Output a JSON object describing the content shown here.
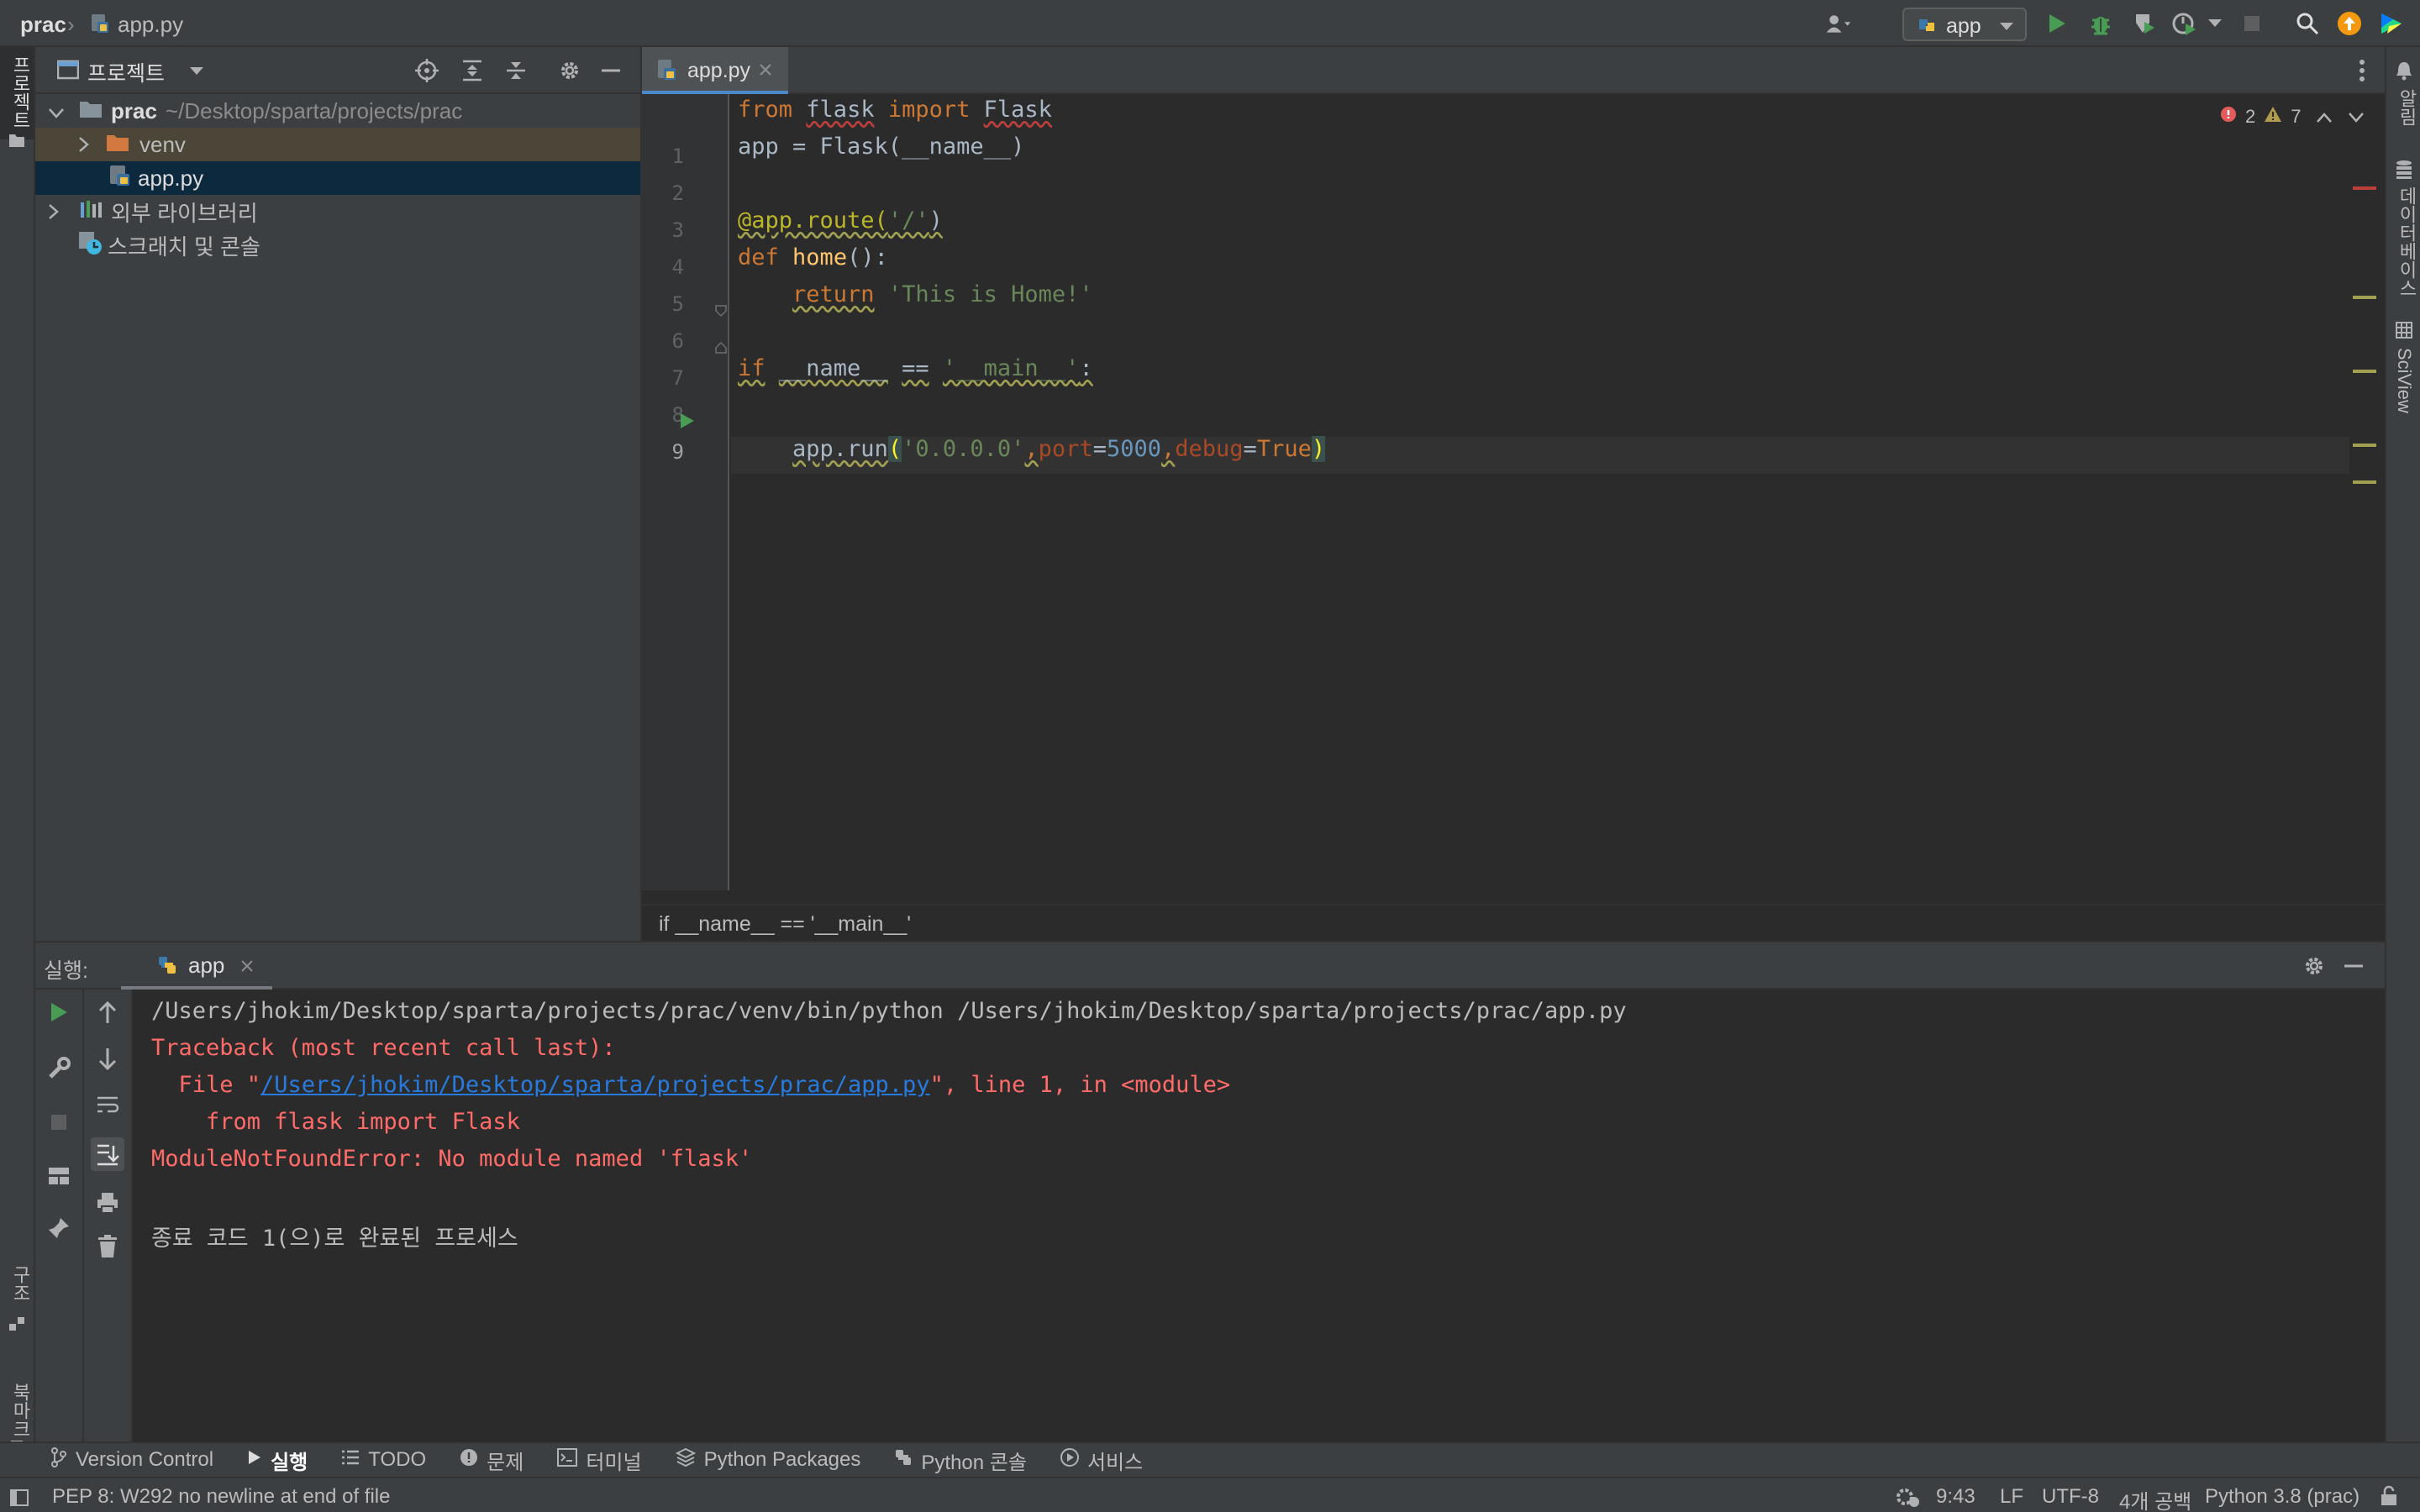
{
  "titlebar": {
    "project": "prac",
    "file": "app.py",
    "run_config": "app"
  },
  "left_strip": {
    "top_tab": "프로젝트",
    "structure_tab": "구조",
    "bookmarks_tab": "북마크"
  },
  "right_strip": {
    "notifications_tab": "알림",
    "database_tab": "데이터베이스",
    "sciview_tab": "SciView"
  },
  "project_panel": {
    "title": "프로젝트",
    "tree": [
      {
        "name": "prac",
        "path": "~/Desktop/sparta/projects/prac"
      },
      {
        "name": "venv"
      },
      {
        "name": "app.py"
      },
      {
        "name": "외부 라이브러리"
      },
      {
        "name": "스크래치 및 콘솔"
      }
    ]
  },
  "editor": {
    "tab_label": "app.py",
    "error_count": "2",
    "warning_count": "7",
    "line_numbers": [
      "1",
      "2",
      "3",
      "4",
      "5",
      "6",
      "7",
      "8",
      "9"
    ],
    "code": {
      "l1_from": "from",
      "l1_module": "flask",
      "l1_import": "import",
      "l1_name": "Flask",
      "l2": "app = Flask(__name__)",
      "l4_decorator": "@app.route(",
      "l4_arg": "'/'",
      "l4_close": ")",
      "l5_def": "def",
      "l5_fn": "home",
      "l5_rest": "():",
      "l6_return": "return",
      "l6_str": "'This is Home!'",
      "l8_if": "if",
      "l8_name": "__name__",
      "l8_eq": "==",
      "l8_str": "'__main__'",
      "l8_colon": ":",
      "l9_call": "app.run",
      "l9_open": "(",
      "l9_host": "'0.0.0.0'",
      "l9_comma1": ",",
      "l9_port_kw": "port",
      "l9_eq1": "=",
      "l9_port_val": "5000",
      "l9_comma2": ",",
      "l9_debug_kw": "debug",
      "l9_eq2": "=",
      "l9_debug_val": "True",
      "l9_close": ")"
    },
    "breadcrumb": "if __name__ == '__main__'"
  },
  "run_panel": {
    "label": "실행:",
    "tab": "app",
    "output": {
      "cmd": "/Users/jhokim/Desktop/sparta/projects/prac/venv/bin/python /Users/jhokim/Desktop/sparta/projects/prac/app.py",
      "traceback": "Traceback (most recent call last):",
      "file_prefix": "  File \"",
      "file_link": "/Users/jhokim/Desktop/sparta/projects/prac/app.py",
      "file_suffix": "\", line 1, in <module>",
      "source_line": "    from flask import Flask",
      "error": "ModuleNotFoundError: No module named 'flask'",
      "exit": "종료 코드 1(으)로 완료된 프로세스"
    }
  },
  "tool_tabs": [
    {
      "label": "Version Control",
      "icon": "branch-icon"
    },
    {
      "label": "실행",
      "icon": "run-icon"
    },
    {
      "label": "TODO",
      "icon": "list-icon"
    },
    {
      "label": "문제",
      "icon": "problems-icon"
    },
    {
      "label": "터미널",
      "icon": "terminal-icon"
    },
    {
      "label": "Python Packages",
      "icon": "packages-icon"
    },
    {
      "label": "Python 콘솔",
      "icon": "python-icon"
    },
    {
      "label": "서비스",
      "icon": "services-icon"
    }
  ],
  "statusbar": {
    "message": "PEP 8: W292 no newline at end of file",
    "position": "9:43",
    "line_sep": "LF",
    "encoding": "UTF-8",
    "indent": "4개 공백",
    "interpreter": "Python 3.8 (prac)"
  },
  "colors": {
    "accent": "#4a88c7",
    "error": "#ff6b68",
    "run_green": "#499c54",
    "selection": "#0d293e"
  }
}
